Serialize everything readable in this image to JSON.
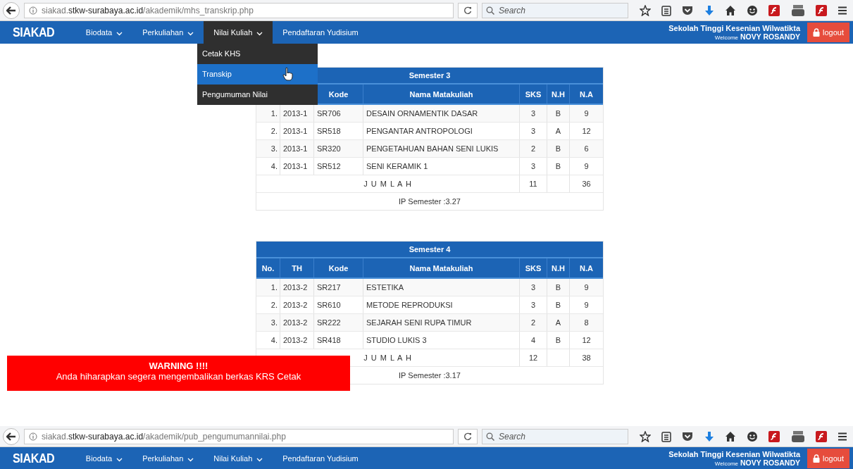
{
  "screens": [
    {
      "browser": {
        "url": {
          "prefix": "siakad.",
          "domain": "stkw-surabaya.ac.id",
          "path": "/akademik/mhs_transkrip.php"
        },
        "search_placeholder": "Search"
      },
      "navbar": {
        "logo": "SIAKAD",
        "items": [
          {
            "label": "Biodata",
            "caret": true,
            "open": false
          },
          {
            "label": "Perkuliahan",
            "caret": true,
            "open": false
          },
          {
            "label": "Nilai Kuliah",
            "caret": true,
            "open": true
          },
          {
            "label": "Pendaftaran Yudisium",
            "caret": false,
            "open": false
          }
        ],
        "school": "Sekolah Tinggi Kesenian Wilwatikta",
        "welcome": "Welcome",
        "user": "NOVY ROSANDY",
        "logout": "logout"
      },
      "dropdown": [
        {
          "label": "Cetak KHS",
          "selected": false
        },
        {
          "label": "Transkip",
          "selected": true
        },
        {
          "label": "Pengumuman Nilai",
          "selected": false
        }
      ],
      "semesters": [
        {
          "title": "Semester 3",
          "columns": [
            "",
            "",
            "Kode",
            "Nama Matakuliah",
            "SKS",
            "N.H",
            "N.A"
          ],
          "rows": [
            [
              "1.",
              "2013-1",
              "SR706",
              "DESAIN ORNAMENTIK DASAR",
              "3",
              "B",
              "9"
            ],
            [
              "2.",
              "2013-1",
              "SR518",
              "PENGANTAR ANTROPOLOGI",
              "3",
              "A",
              "12"
            ],
            [
              "3.",
              "2013-1",
              "SR320",
              "PENGETAHUAN BAHAN SENI LUKIS",
              "2",
              "B",
              "6"
            ],
            [
              "4.",
              "2013-1",
              "SR512",
              "SENI KERAMIK 1",
              "3",
              "B",
              "9"
            ]
          ],
          "total": {
            "label": "J U M L A H",
            "sks": "11",
            "na": "36"
          },
          "ip": "IP Semester :3.27"
        },
        {
          "title": "Semester 4",
          "columns": [
            "No.",
            "TH",
            "Kode",
            "Nama Matakuliah",
            "SKS",
            "N.H",
            "N.A"
          ],
          "rows": [
            [
              "1.",
              "2013-2",
              "SR217",
              "ESTETIKA",
              "3",
              "B",
              "9"
            ],
            [
              "2.",
              "2013-2",
              "SR610",
              "METODE REPRODUKSI",
              "3",
              "B",
              "9"
            ],
            [
              "3.",
              "2013-2",
              "SR222",
              "SEJARAH SENI RUPA TIMUR",
              "2",
              "A",
              "8"
            ],
            [
              "4.",
              "2013-2",
              "SR418",
              "STUDIO LUKIS 3",
              "4",
              "B",
              "12"
            ]
          ],
          "total": {
            "label": "J U M L A H",
            "sks": "12",
            "na": "38"
          },
          "ip": "IP Semester :3.17"
        }
      ],
      "warning": {
        "title": "WARNING !!!!",
        "text": "Anda hiharapkan segera mengembalikan berkas KRS Cetak"
      }
    },
    {
      "browser": {
        "url": {
          "prefix": "siakad.",
          "domain": "stkw-surabaya.ac.id",
          "path": "/akademik/pub_pengumumannilai.php"
        },
        "search_placeholder": "Search"
      },
      "navbar": {
        "logo": "SIAKAD",
        "items": [
          {
            "label": "Biodata",
            "caret": true,
            "open": false
          },
          {
            "label": "Perkuliahan",
            "caret": true,
            "open": false
          },
          {
            "label": "Nilai Kuliah",
            "caret": true,
            "open": false
          },
          {
            "label": "Pendaftaran Yudisium",
            "caret": false,
            "open": false
          }
        ],
        "school": "Sekolah Tinggi Kesenian Wilwatikta",
        "welcome": "Welcome",
        "user": "NOVY ROSANDY",
        "logout": "logout"
      }
    }
  ]
}
